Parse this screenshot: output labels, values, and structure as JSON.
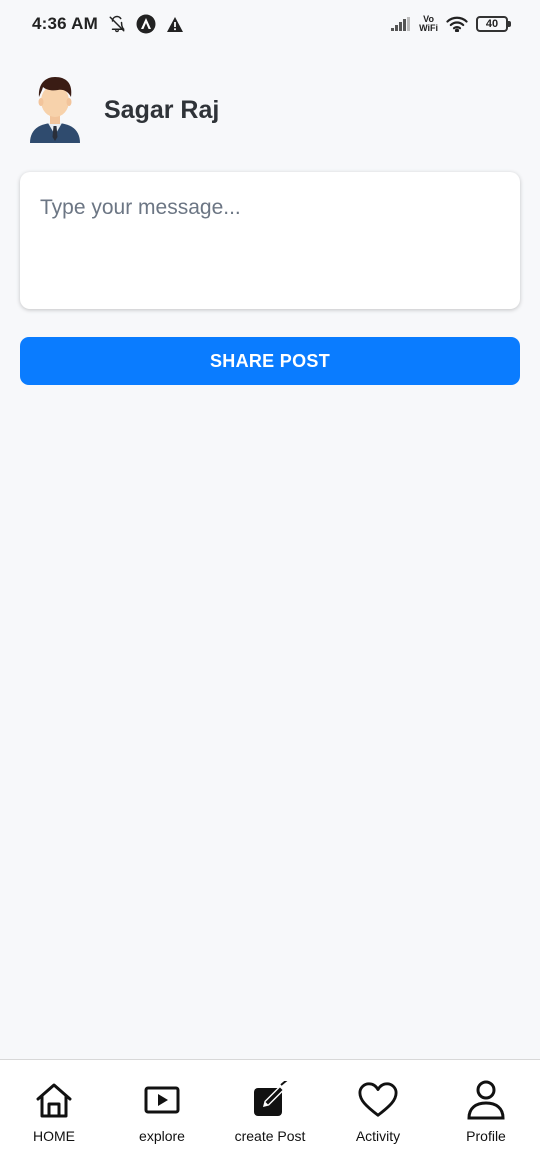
{
  "status_bar": {
    "time": "4:36 AM",
    "volte_top": "Vo",
    "volte_bottom": "WiFi",
    "battery": "40"
  },
  "profile": {
    "name": "Sagar Raj"
  },
  "composer": {
    "placeholder": "Type your message...",
    "value": ""
  },
  "share_button": {
    "label": "SHARE POST",
    "color": "#0a7cff"
  },
  "bottom_nav": {
    "items": [
      {
        "label": "HOME",
        "icon": "home-icon"
      },
      {
        "label": "explore",
        "icon": "play-square-icon"
      },
      {
        "label": "create Post",
        "icon": "edit-square-icon"
      },
      {
        "label": "Activity",
        "icon": "heart-icon"
      },
      {
        "label": "Profile",
        "icon": "user-icon"
      }
    ]
  }
}
